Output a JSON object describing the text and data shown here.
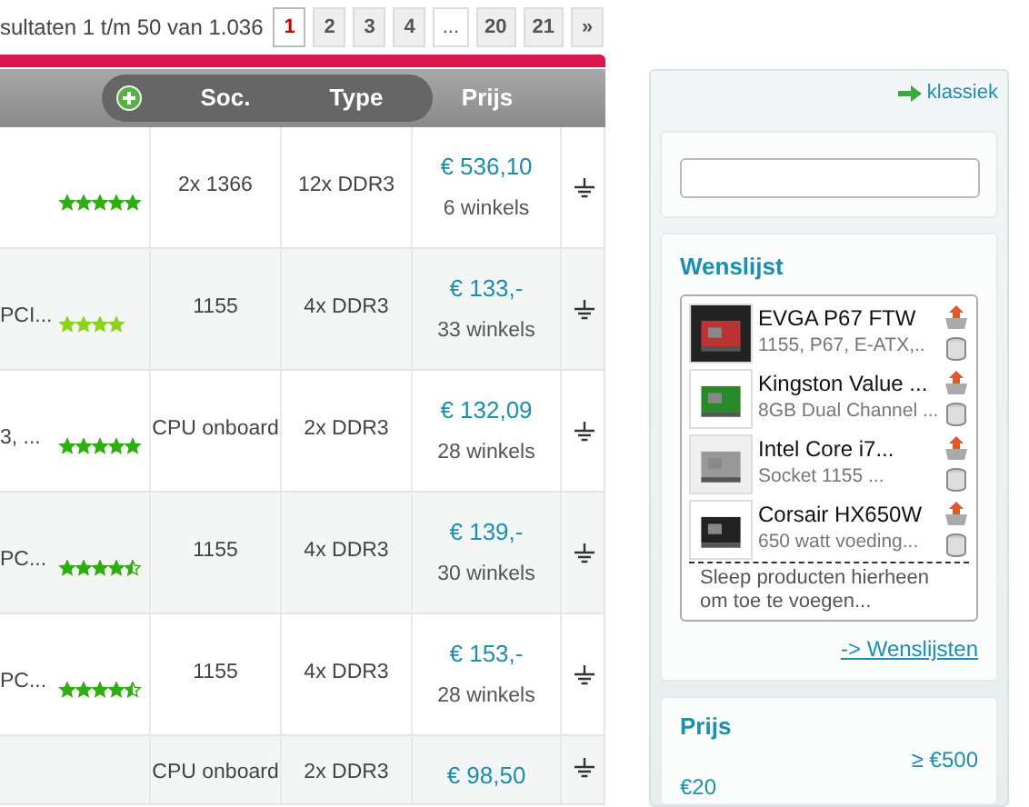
{
  "results_text": "sultaten 1 t/m 50 van 1.036",
  "pagination": [
    {
      "label": "1",
      "selected": true
    },
    {
      "label": "2",
      "selected": false
    },
    {
      "label": "3",
      "selected": false
    },
    {
      "label": "4",
      "selected": false
    },
    {
      "label": "...",
      "selected": false
    },
    {
      "label": "20",
      "selected": false
    },
    {
      "label": "21",
      "selected": false
    },
    {
      "label": "»",
      "selected": false
    }
  ],
  "table": {
    "columns": [
      "Soc.",
      "Type",
      "Prijs"
    ],
    "rows": [
      {
        "stars": 5,
        "socket": "2x 1366",
        "memory": "12x DDR3",
        "price": "€ 536,10",
        "shops": "6 winkels"
      },
      {
        "specs": "PCI...",
        "stars": 4,
        "socket": "1155",
        "memory": "4x DDR3",
        "price": "€ 133,-",
        "shops": "33 winkels"
      },
      {
        "specs": "3, ...",
        "stars": 5,
        "socket": "CPU onboard",
        "memory": "2x DDR3",
        "price": "€ 132,09",
        "shops": "28 winkels"
      },
      {
        "specs": "PC...",
        "stars": 4.5,
        "socket": "1155",
        "memory": "4x DDR3",
        "price": "€ 139,-",
        "shops": "30 winkels"
      },
      {
        "specs": "PC...",
        "stars": 4.5,
        "socket": "1155",
        "memory": "4x DDR3",
        "price": "€ 153,-",
        "shops": "28 winkels"
      },
      {
        "socket": "CPU onboard",
        "memory": "2x DDR3",
        "price": "€ 98,50"
      }
    ]
  },
  "sidebar": {
    "classic_link": "klassiek",
    "wishlist": {
      "title": "Wenslijst",
      "items": [
        {
          "name": "EVGA P67 FTW",
          "description": "1155, P67, E-ATX,.."
        },
        {
          "name": "Kingston Value ...",
          "description": "8GB Dual Channel ..."
        },
        {
          "name": "Intel Core i7...",
          "description": "Socket 1155 ..."
        },
        {
          "name": "Corsair HX650W",
          "description": "650 watt voeding..."
        }
      ],
      "drop_hint": "Sleep producten hierheen om toe te voegen...",
      "link": "-> Wenslijsten"
    },
    "price_filter": {
      "title": "Prijs",
      "max_label": "≥ €500",
      "min_label": "€20"
    }
  }
}
